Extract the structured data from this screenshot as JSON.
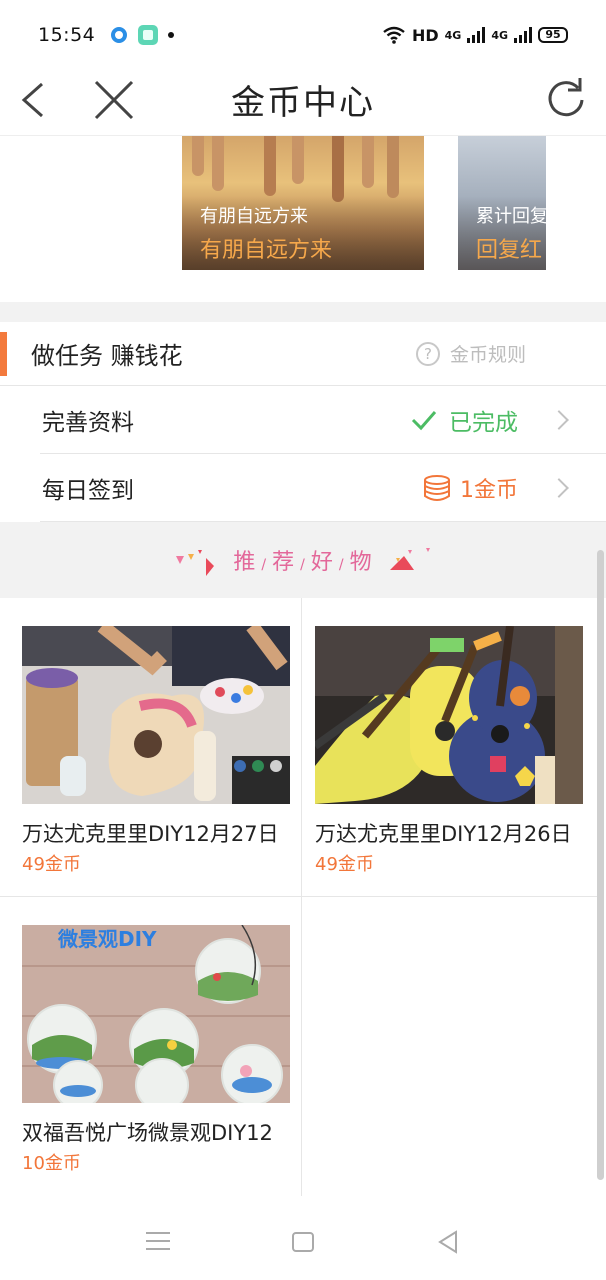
{
  "status_bar": {
    "time": "15:54",
    "network": "HD",
    "signal_1": "4G",
    "signal_2": "4G",
    "battery": "95"
  },
  "nav": {
    "title": "金币中心",
    "icons": [
      "back-icon",
      "close-icon",
      "refresh-icon"
    ]
  },
  "banners": [
    {
      "subtitle": "有朋自远方来",
      "title": "有朋自远方来"
    },
    {
      "subtitle": "累计回复",
      "title": "回复红"
    }
  ],
  "tasks": {
    "title": "做任务 赚钱花",
    "rules_label": "金币规则",
    "items": [
      {
        "label": "完善资料",
        "status": "已完成",
        "status_color": "#4cbc64"
      },
      {
        "label": "每日签到",
        "status": "1金币",
        "status_color": "#f2763a"
      }
    ]
  },
  "recommend": {
    "chars": [
      "推",
      "荐",
      "好",
      "物"
    ],
    "sep": "/",
    "accent_color": "#e3689a"
  },
  "products": [
    {
      "name": "万达尤克里里DIY12月27日",
      "price": "49金币"
    },
    {
      "name": "万达尤克里里DIY12月26日",
      "price": "49金币"
    },
    {
      "name": "双福吾悦广场微景观DIY12",
      "price": "10金币",
      "image_text": "微景观DIY"
    }
  ],
  "colors": {
    "accent_orange": "#f37a3d",
    "price_orange": "#f2763a",
    "done_green": "#4cbc64"
  }
}
